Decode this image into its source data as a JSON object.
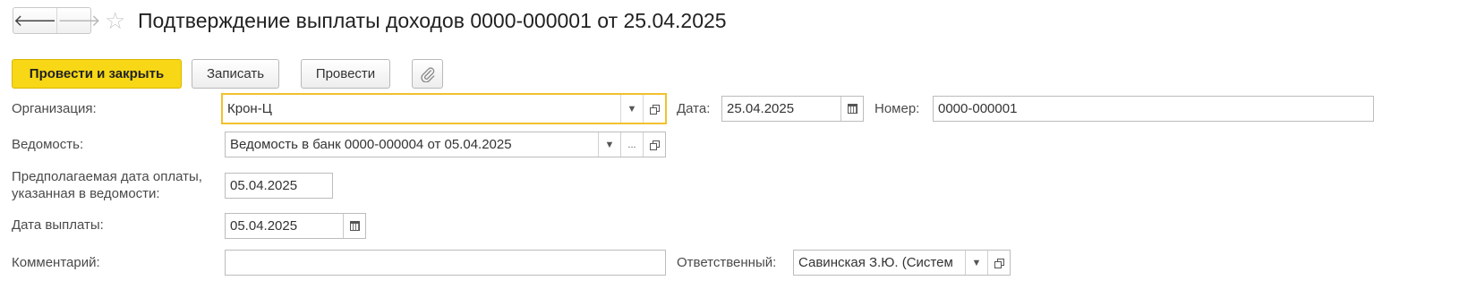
{
  "nav": {
    "back": "🡐",
    "forward": "🡒",
    "favorite": "☆"
  },
  "header": {
    "title": "Подтверждение выплаты доходов 0000-000001 от 25.04.2025"
  },
  "toolbar": {
    "post_close": "Провести и закрыть",
    "save": "Записать",
    "post": "Провести",
    "attach_icon": "paperclip"
  },
  "form": {
    "organization": {
      "label": "Организация:",
      "value": "Крон-Ц"
    },
    "date": {
      "label": "Дата:",
      "value": "25.04.2025"
    },
    "number": {
      "label": "Номер:",
      "value": "0000-000001"
    },
    "statement": {
      "label": "Ведомость:",
      "value": "Ведомость в банк 0000-000004 от 05.04.2025",
      "select_btn": "..."
    },
    "expected_date": {
      "label_line1": "Предполагаемая дата оплаты,",
      "label_line2": "указанная в ведомости:",
      "value": "05.04.2025"
    },
    "payment_date": {
      "label": "Дата выплаты:",
      "value": "05.04.2025"
    },
    "comment": {
      "label": "Комментарий:",
      "value": ""
    },
    "responsible": {
      "label": "Ответственный:",
      "value": "Савинская З.Ю. (Систем"
    }
  },
  "colors": {
    "primary": "#f7d716",
    "focus": "#f2c12e"
  }
}
